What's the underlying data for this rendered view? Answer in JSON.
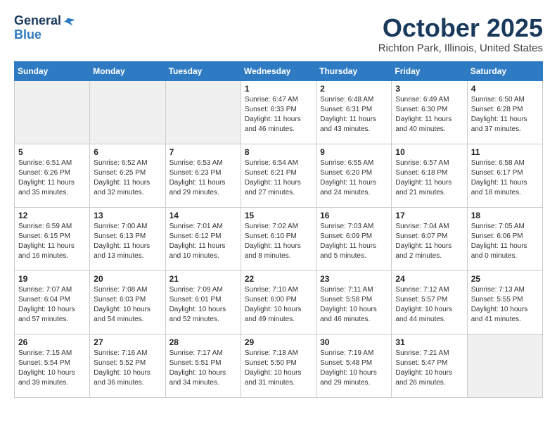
{
  "header": {
    "logo_line1": "General",
    "logo_line2": "Blue",
    "month": "October 2025",
    "location": "Richton Park, Illinois, United States"
  },
  "weekdays": [
    "Sunday",
    "Monday",
    "Tuesday",
    "Wednesday",
    "Thursday",
    "Friday",
    "Saturday"
  ],
  "weeks": [
    [
      {
        "day": "",
        "info": "",
        "shaded": true
      },
      {
        "day": "",
        "info": "",
        "shaded": true
      },
      {
        "day": "",
        "info": "",
        "shaded": true
      },
      {
        "day": "1",
        "info": "Sunrise: 6:47 AM\nSunset: 6:33 PM\nDaylight: 11 hours\nand 46 minutes.",
        "shaded": false
      },
      {
        "day": "2",
        "info": "Sunrise: 6:48 AM\nSunset: 6:31 PM\nDaylight: 11 hours\nand 43 minutes.",
        "shaded": false
      },
      {
        "day": "3",
        "info": "Sunrise: 6:49 AM\nSunset: 6:30 PM\nDaylight: 11 hours\nand 40 minutes.",
        "shaded": false
      },
      {
        "day": "4",
        "info": "Sunrise: 6:50 AM\nSunset: 6:28 PM\nDaylight: 11 hours\nand 37 minutes.",
        "shaded": false
      }
    ],
    [
      {
        "day": "5",
        "info": "Sunrise: 6:51 AM\nSunset: 6:26 PM\nDaylight: 11 hours\nand 35 minutes.",
        "shaded": false
      },
      {
        "day": "6",
        "info": "Sunrise: 6:52 AM\nSunset: 6:25 PM\nDaylight: 11 hours\nand 32 minutes.",
        "shaded": false
      },
      {
        "day": "7",
        "info": "Sunrise: 6:53 AM\nSunset: 6:23 PM\nDaylight: 11 hours\nand 29 minutes.",
        "shaded": false
      },
      {
        "day": "8",
        "info": "Sunrise: 6:54 AM\nSunset: 6:21 PM\nDaylight: 11 hours\nand 27 minutes.",
        "shaded": false
      },
      {
        "day": "9",
        "info": "Sunrise: 6:55 AM\nSunset: 6:20 PM\nDaylight: 11 hours\nand 24 minutes.",
        "shaded": false
      },
      {
        "day": "10",
        "info": "Sunrise: 6:57 AM\nSunset: 6:18 PM\nDaylight: 11 hours\nand 21 minutes.",
        "shaded": false
      },
      {
        "day": "11",
        "info": "Sunrise: 6:58 AM\nSunset: 6:17 PM\nDaylight: 11 hours\nand 18 minutes.",
        "shaded": false
      }
    ],
    [
      {
        "day": "12",
        "info": "Sunrise: 6:59 AM\nSunset: 6:15 PM\nDaylight: 11 hours\nand 16 minutes.",
        "shaded": false
      },
      {
        "day": "13",
        "info": "Sunrise: 7:00 AM\nSunset: 6:13 PM\nDaylight: 11 hours\nand 13 minutes.",
        "shaded": false
      },
      {
        "day": "14",
        "info": "Sunrise: 7:01 AM\nSunset: 6:12 PM\nDaylight: 11 hours\nand 10 minutes.",
        "shaded": false
      },
      {
        "day": "15",
        "info": "Sunrise: 7:02 AM\nSunset: 6:10 PM\nDaylight: 11 hours\nand 8 minutes.",
        "shaded": false
      },
      {
        "day": "16",
        "info": "Sunrise: 7:03 AM\nSunset: 6:09 PM\nDaylight: 11 hours\nand 5 minutes.",
        "shaded": false
      },
      {
        "day": "17",
        "info": "Sunrise: 7:04 AM\nSunset: 6:07 PM\nDaylight: 11 hours\nand 2 minutes.",
        "shaded": false
      },
      {
        "day": "18",
        "info": "Sunrise: 7:05 AM\nSunset: 6:06 PM\nDaylight: 11 hours\nand 0 minutes.",
        "shaded": false
      }
    ],
    [
      {
        "day": "19",
        "info": "Sunrise: 7:07 AM\nSunset: 6:04 PM\nDaylight: 10 hours\nand 57 minutes.",
        "shaded": false
      },
      {
        "day": "20",
        "info": "Sunrise: 7:08 AM\nSunset: 6:03 PM\nDaylight: 10 hours\nand 54 minutes.",
        "shaded": false
      },
      {
        "day": "21",
        "info": "Sunrise: 7:09 AM\nSunset: 6:01 PM\nDaylight: 10 hours\nand 52 minutes.",
        "shaded": false
      },
      {
        "day": "22",
        "info": "Sunrise: 7:10 AM\nSunset: 6:00 PM\nDaylight: 10 hours\nand 49 minutes.",
        "shaded": false
      },
      {
        "day": "23",
        "info": "Sunrise: 7:11 AM\nSunset: 5:58 PM\nDaylight: 10 hours\nand 46 minutes.",
        "shaded": false
      },
      {
        "day": "24",
        "info": "Sunrise: 7:12 AM\nSunset: 5:57 PM\nDaylight: 10 hours\nand 44 minutes.",
        "shaded": false
      },
      {
        "day": "25",
        "info": "Sunrise: 7:13 AM\nSunset: 5:55 PM\nDaylight: 10 hours\nand 41 minutes.",
        "shaded": false
      }
    ],
    [
      {
        "day": "26",
        "info": "Sunrise: 7:15 AM\nSunset: 5:54 PM\nDaylight: 10 hours\nand 39 minutes.",
        "shaded": false
      },
      {
        "day": "27",
        "info": "Sunrise: 7:16 AM\nSunset: 5:52 PM\nDaylight: 10 hours\nand 36 minutes.",
        "shaded": false
      },
      {
        "day": "28",
        "info": "Sunrise: 7:17 AM\nSunset: 5:51 PM\nDaylight: 10 hours\nand 34 minutes.",
        "shaded": false
      },
      {
        "day": "29",
        "info": "Sunrise: 7:18 AM\nSunset: 5:50 PM\nDaylight: 10 hours\nand 31 minutes.",
        "shaded": false
      },
      {
        "day": "30",
        "info": "Sunrise: 7:19 AM\nSunset: 5:48 PM\nDaylight: 10 hours\nand 29 minutes.",
        "shaded": false
      },
      {
        "day": "31",
        "info": "Sunrise: 7:21 AM\nSunset: 5:47 PM\nDaylight: 10 hours\nand 26 minutes.",
        "shaded": false
      },
      {
        "day": "",
        "info": "",
        "shaded": true
      }
    ]
  ]
}
